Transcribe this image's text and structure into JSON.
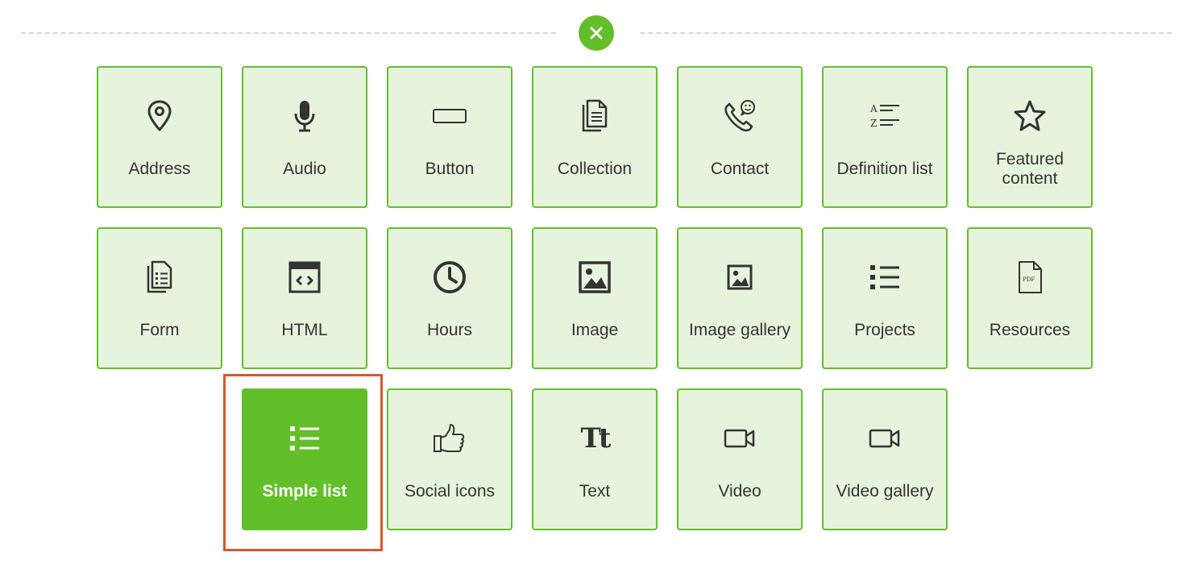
{
  "close_button": {
    "icon": "close-icon",
    "color": "#63bf29"
  },
  "accent_color": "#63bf29",
  "highlight_color": "#d9572f",
  "tiles": [
    {
      "label": "Address",
      "icon": "map-pin-icon",
      "selected": false
    },
    {
      "label": "Audio",
      "icon": "microphone-icon",
      "selected": false
    },
    {
      "label": "Button",
      "icon": "button-icon",
      "selected": false
    },
    {
      "label": "Collection",
      "icon": "documents-icon",
      "selected": false
    },
    {
      "label": "Contact",
      "icon": "phone-chat-icon",
      "selected": false
    },
    {
      "label": "Definition list",
      "icon": "definition-list-icon",
      "selected": false
    },
    {
      "label": "Featured content",
      "icon": "star-icon",
      "selected": false
    },
    {
      "label": "Form",
      "icon": "form-icon",
      "selected": false
    },
    {
      "label": "HTML",
      "icon": "code-icon",
      "selected": false
    },
    {
      "label": "Hours",
      "icon": "clock-icon",
      "selected": false
    },
    {
      "label": "Image",
      "icon": "image-icon",
      "selected": false
    },
    {
      "label": "Image gallery",
      "icon": "image-gallery-icon",
      "selected": false
    },
    {
      "label": "Projects",
      "icon": "bullet-list-icon",
      "selected": false
    },
    {
      "label": "Resources",
      "icon": "pdf-file-icon",
      "selected": false
    },
    {
      "label": "Simple list",
      "icon": "bullet-list-icon",
      "selected": true
    },
    {
      "label": "Social icons",
      "icon": "thumbs-up-icon",
      "selected": false
    },
    {
      "label": "Text",
      "icon": "text-icon",
      "selected": false
    },
    {
      "label": "Video",
      "icon": "video-camera-icon",
      "selected": false
    },
    {
      "label": "Video gallery",
      "icon": "video-camera-icon",
      "selected": false
    }
  ]
}
